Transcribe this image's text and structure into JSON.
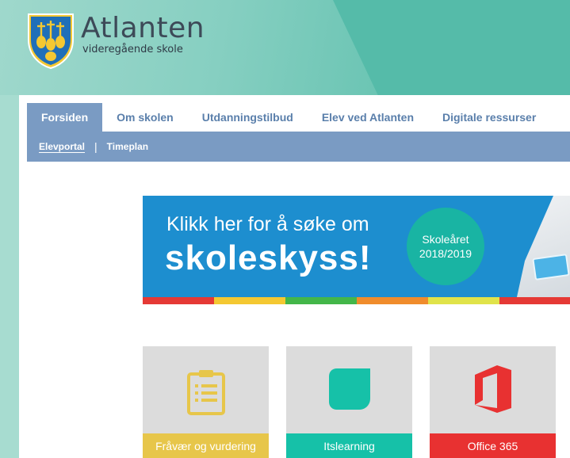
{
  "site": {
    "title": "Atlanten",
    "subtitle": "videregående skole"
  },
  "nav": {
    "tabs": [
      {
        "label": "Forsiden",
        "active": true
      },
      {
        "label": "Om skolen",
        "active": false
      },
      {
        "label": "Utdanningstilbud",
        "active": false
      },
      {
        "label": "Elev ved Atlanten",
        "active": false
      },
      {
        "label": "Digitale ressurser",
        "active": false
      }
    ],
    "subitems": [
      {
        "label": "Elevportal",
        "active": true
      },
      {
        "label": "Timeplan",
        "active": false
      }
    ]
  },
  "banner": {
    "line1": "Klikk her for å søke om",
    "line2": "skoleskyss!",
    "badge_line1": "Skoleåret",
    "badge_line2": "2018/2019"
  },
  "tiles": [
    {
      "label": "Fråvær og vurdering",
      "icon": "clipboard-icon",
      "color": "#e7c64a"
    },
    {
      "label": "Itslearning",
      "icon": "itslearning-icon",
      "color": "#16c1a8"
    },
    {
      "label": "Office 365",
      "icon": "office-icon",
      "color": "#e83131"
    }
  ],
  "colors": {
    "nav_accent": "#7a9bc3",
    "nav_text": "#5a7fab",
    "banner_bg": "#1d8ecf",
    "badge_bg": "#19b4a3"
  }
}
